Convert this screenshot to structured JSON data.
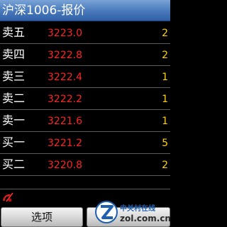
{
  "title": "沪深1006-报价",
  "quotes": [
    {
      "label": "卖五",
      "price": "3223.0",
      "volume": "2"
    },
    {
      "label": "卖四",
      "price": "3222.8",
      "volume": "2"
    },
    {
      "label": "卖三",
      "price": "3222.4",
      "volume": "1"
    },
    {
      "label": "卖二",
      "price": "3222.2",
      "volume": "1"
    },
    {
      "label": "卖一",
      "price": "3221.6",
      "volume": "1"
    },
    {
      "label": "买一",
      "price": "3221.2",
      "volume": "5"
    },
    {
      "label": "买二",
      "price": "3220.8",
      "volume": "2"
    }
  ],
  "softkeys": {
    "left_label": "选项",
    "right_label": ""
  },
  "watermark": {
    "brand": "中关村在线",
    "domain": "zol.com.cn"
  },
  "colors": {
    "price": "#ff2222",
    "volume": "#ffd200",
    "title_bar": "#4f7fc0"
  },
  "icons": {
    "status": "connection-status-icon",
    "logo": "zol-logo-icon"
  }
}
